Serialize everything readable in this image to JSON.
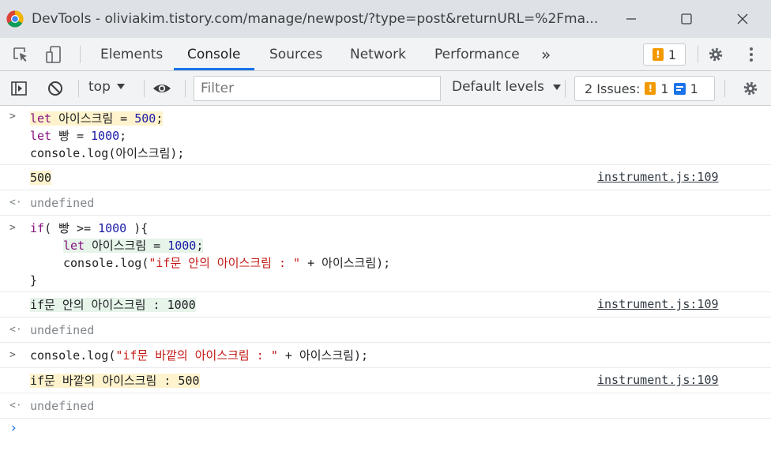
{
  "window": {
    "app_name": "DevTools",
    "separator": " - ",
    "url": "oliviakim.tistory.com/manage/newpost/?type=post&returnURL=%2Fma..."
  },
  "tabs": {
    "elements": "Elements",
    "console": "Console",
    "sources": "Sources",
    "network": "Network",
    "performance": "Performance",
    "more": "»",
    "warning_count": "1"
  },
  "toolbar": {
    "context": "top",
    "filter_placeholder": "Filter",
    "levels": "Default levels",
    "issues_label": "2 Issues:",
    "issues_warn_count": "1",
    "issues_info_count": "1"
  },
  "console": {
    "entry1": {
      "line1_kw": "let",
      "line1_rest": " 아이스크림 = ",
      "line1_num": "500",
      "line1_end": ";",
      "line2_kw": "let",
      "line2_rest": " 빵 = ",
      "line2_num": "1000",
      "line2_end": ";",
      "line3": "console.log(아이스크림);"
    },
    "out1": {
      "value": "500",
      "source": "instrument.js:109"
    },
    "ret1": "undefined",
    "entry2": {
      "line1_kw": "if",
      "line1_rest": "( 빵 >= ",
      "line1_num": "1000",
      "line1_end": " ){",
      "line2_kw": "let",
      "line2_rest": " 아이스크림 = ",
      "line2_num": "1000",
      "line2_end": ";",
      "line3_pre": "console.log(",
      "line3_str": "\"if문 안의 아이스크림 : \"",
      "line3_end": " + 아이스크림);",
      "line4": "}"
    },
    "out2": {
      "value": "if문 안의 아이스크림 : 1000",
      "source": "instrument.js:109"
    },
    "ret2": "undefined",
    "entry3": {
      "pre": "console.log(",
      "str": "\"if문 바깥의 아이스크림 : \"",
      "end": " + 아이스크림);"
    },
    "out3": {
      "value": "if문 바깥의 아이스크림 : 500",
      "source": "instrument.js:109"
    },
    "ret3": "undefined"
  }
}
